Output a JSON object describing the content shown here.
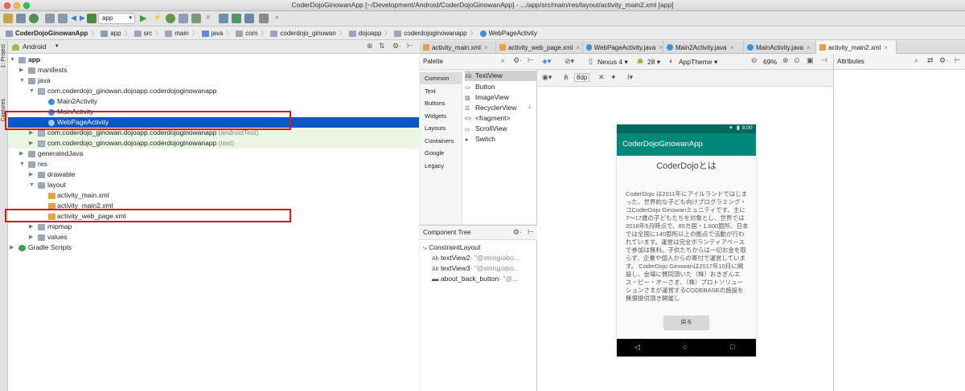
{
  "window": {
    "title": "CoderDojoGinowanApp [~/Development/Android/CoderDojoGinowanApp] - .../app/src/main/res/layout/activity_main2.xml [app]"
  },
  "toolbar": {
    "run_config": "app"
  },
  "breadcrumb": [
    "CoderDojoGinowanApp",
    "app",
    "src",
    "main",
    "java",
    "com",
    "coderdojo_ginowan",
    "dojoapp",
    "coderdojoginowanapp",
    "WebPageActivity"
  ],
  "side_strip": {
    "project": "1: Project",
    "captures": "Captures"
  },
  "project_panel": {
    "view_mode": "Android"
  },
  "tree": {
    "app": "app",
    "manifests": "manifests",
    "java": "java",
    "pkg_main": "com.coderdojo_ginowan.dojoapp.coderdojoginowanapp",
    "main2activity": "Main2Activity",
    "mainactivity": "MainActivity",
    "webpageactivity": "WebPageActivity",
    "pkg_android_test": "com.coderdojo_ginowan.dojoapp.coderdojoginowanapp",
    "pkg_android_test_suffix": "(androidTest)",
    "pkg_test": "com.coderdojo_ginowan.dojoapp.coderdojoginowanapp",
    "pkg_test_suffix": "(test)",
    "generatedjava": "generatedJava",
    "res": "res",
    "drawable": "drawable",
    "layout": "layout",
    "activity_main": "activity_main.xml",
    "activity_main2": "activity_main2.xml",
    "activity_web_page": "activity_web_page.xml",
    "mipmap": "mipmap",
    "values": "values",
    "gradle_scripts": "Gradle Scripts"
  },
  "editor_tabs": [
    {
      "label": "activity_main.xml"
    },
    {
      "label": "activity_web_page.xml"
    },
    {
      "label": "WebPageActivity.java"
    },
    {
      "label": "Main2Activity.java"
    },
    {
      "label": "MainActivity.java"
    },
    {
      "label": "activity_main2.xml"
    }
  ],
  "palette": {
    "title": "Palette",
    "categories": [
      "Common",
      "Text",
      "Buttons",
      "Widgets",
      "Layouts",
      "Containers",
      "Google",
      "Legacy"
    ],
    "items": [
      {
        "icon": "Ab",
        "label": "TextView"
      },
      {
        "icon": "▭",
        "label": "Button"
      },
      {
        "icon": "▨",
        "label": "ImageView"
      },
      {
        "icon": "☰",
        "label": "RecyclerView"
      },
      {
        "icon": "<>",
        "label": "<fragment>"
      },
      {
        "icon": "▭",
        "label": "ScrollView"
      },
      {
        "icon": "●",
        "label": "Switch"
      }
    ]
  },
  "component_tree": {
    "title": "Component Tree",
    "root": "ConstraintLayout",
    "children": [
      {
        "icon": "Ab",
        "name": "textView2",
        "hint": "- \"@string/abo..."
      },
      {
        "icon": "Ab",
        "name": "textView3",
        "hint": "- \"@string/abo..."
      },
      {
        "icon": "▬",
        "name": "about_back_button",
        "hint": "- \"@..."
      }
    ]
  },
  "design_toolbar": {
    "device": "Nexus 4",
    "api": "28",
    "theme": "AppTheme",
    "zoom": "69%",
    "margin": "8dp"
  },
  "phone": {
    "time": "8:00",
    "app_title": "CoderDojoGinowanApp",
    "heading": "CoderDojoとは",
    "body": "CoderDojo は2011年にアイルランドではじまった、世界的な子ども向けプログラミング・コCoderDojo Ginowanミュニティです。主に7〜17歳の子どもたちを対象とし、世界では2018年5月時点で、85カ国・1,600箇所、日本では全国に140箇所以上の拠点で活動が行われています。運営は完全ボランティアベースで参加は無料。子供たちからは一切お金を取らず、企業や個人からの寄付で運営しています。 CoderDojo Ginowanは2017年10月に開設し、会場に賛同頂いた（株）おきぎんエス・ピー・オーさま、（株）プロトソリューションさまが運営するCODEBASEの施設を無償提供頂き開催し",
    "button": "戻る"
  },
  "attributes": {
    "title": "Attributes"
  }
}
